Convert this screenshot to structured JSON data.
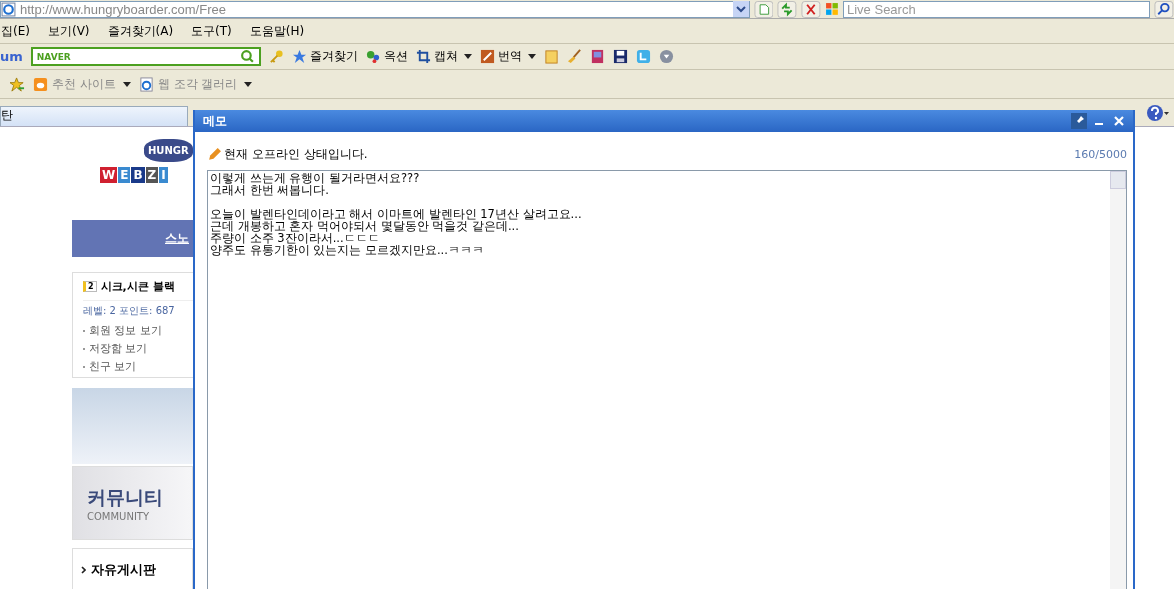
{
  "address_bar": {
    "url": "http://www.hungryboarder.com/Free",
    "search_placeholder": "Live Search"
  },
  "menu_bar": [
    "집(E)",
    "보기(V)",
    "즐겨찾기(A)",
    "도구(T)",
    "도움말(H)"
  ],
  "toolbar": {
    "logo": "um",
    "search_brand": "NAVER",
    "items": [
      {
        "label": "즐겨찾기",
        "kind": "star",
        "dropdown": false
      },
      {
        "label": "옥션",
        "kind": "dots",
        "dropdown": false
      },
      {
        "label": "캡쳐",
        "kind": "crop",
        "dropdown": true
      },
      {
        "label": "번역",
        "kind": "translate",
        "dropdown": true
      }
    ]
  },
  "favorites_bar": [
    {
      "label": "추천 사이트",
      "kind": "site"
    },
    {
      "label": "웹 조각 갤러리",
      "kind": "ie"
    }
  ],
  "tab": {
    "label": "탄"
  },
  "page": {
    "logo": [
      "HUNGR",
      "W",
      "E",
      "B",
      "Z",
      "I"
    ],
    "nav_label": "스노",
    "user_box": {
      "badge": "2",
      "name": "시크,시큰 블랙",
      "stats": "레벨: 2  포인트: 687",
      "links": [
        "회원 정보 보기",
        "저장함 보기",
        "친구 보기"
      ]
    },
    "banner": {
      "title": "커뮤니티",
      "subtitle": "COMMUNITY"
    },
    "board": {
      "title": "자유게시판"
    }
  },
  "memo": {
    "title": "메모",
    "status": "현재 오프라인 상태입니다.",
    "counter": "160/5000",
    "paragraphs": [
      [
        "이렇게 쓰는게 유행이 될거라면서요???",
        "그래서 한번 써봅니다."
      ],
      [
        "오늘이 발렌타인데이라고 해서 이마트에 발렌타인 17년산 살려고요...",
        "근데 개봉하고 혼자 먹어야되서 몇달동안 먹을것 같은데...",
        "주량이 소주 3잔이라서...ㄷㄷㄷ",
        "양주도 유통기한이 있는지는 모르겠지만요...ㅋㅋㅋ"
      ]
    ]
  }
}
